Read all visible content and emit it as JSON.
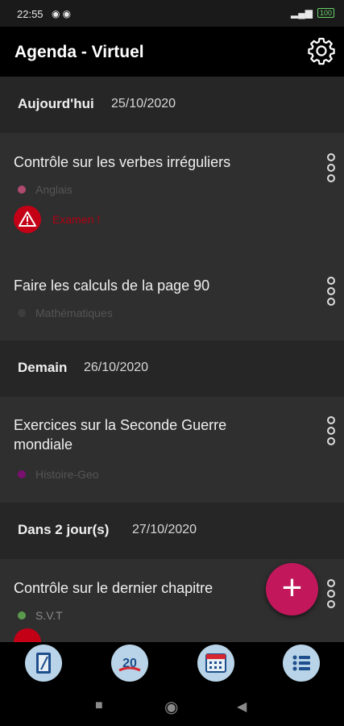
{
  "status_bar": {
    "time": "22:55",
    "battery": "100"
  },
  "app_bar": {
    "title": "Agenda - Virtuel"
  },
  "sections": [
    {
      "label": "Aujourd'hui",
      "date": "25/10/2020",
      "items": [
        {
          "title": "Contrôle sur les verbes irréguliers",
          "subject": "Anglais",
          "subject_color": "#b04a6e",
          "warning": "Examen !"
        },
        {
          "title": "Faire les calculs de la page 90",
          "subject": "Mathématiques",
          "subject_color": "#3d3d3d"
        }
      ]
    },
    {
      "label": "Demain",
      "date": "26/10/2020",
      "items": [
        {
          "title": "Exercices sur la Seconde Guerre mondiale",
          "subject": "Histoire-Geo",
          "subject_color": "#7a1070"
        }
      ]
    },
    {
      "label": "Dans 2 jour(s)",
      "date": "27/10/2020",
      "items": [
        {
          "title": "Contrôle sur le dernier chapitre",
          "subject": "S.V.T",
          "subject_color": "#5a9a4e"
        }
      ]
    }
  ],
  "fab": {
    "label": "+"
  },
  "bottom_nav": [
    {
      "icon": "notebook-icon"
    },
    {
      "icon": "grade-20-icon"
    },
    {
      "icon": "calendar-icon"
    },
    {
      "icon": "list-icon"
    }
  ],
  "colors": {
    "accent": "#c2185b",
    "warning": "#c40016"
  }
}
